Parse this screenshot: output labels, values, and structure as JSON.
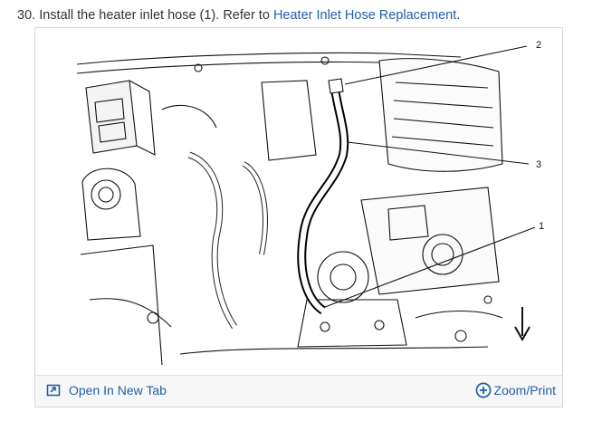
{
  "step": {
    "number": "30.",
    "text": "Install the heater inlet hose (1). Refer to",
    "link": "Heater Inlet Hose Replacement",
    "end": "."
  },
  "figure": {
    "callouts": [
      "2",
      "3",
      "1"
    ],
    "open_tab_label": "Open In New Tab",
    "zoom_label": "Zoom/Print",
    "link_color": "#1f5fa8"
  }
}
